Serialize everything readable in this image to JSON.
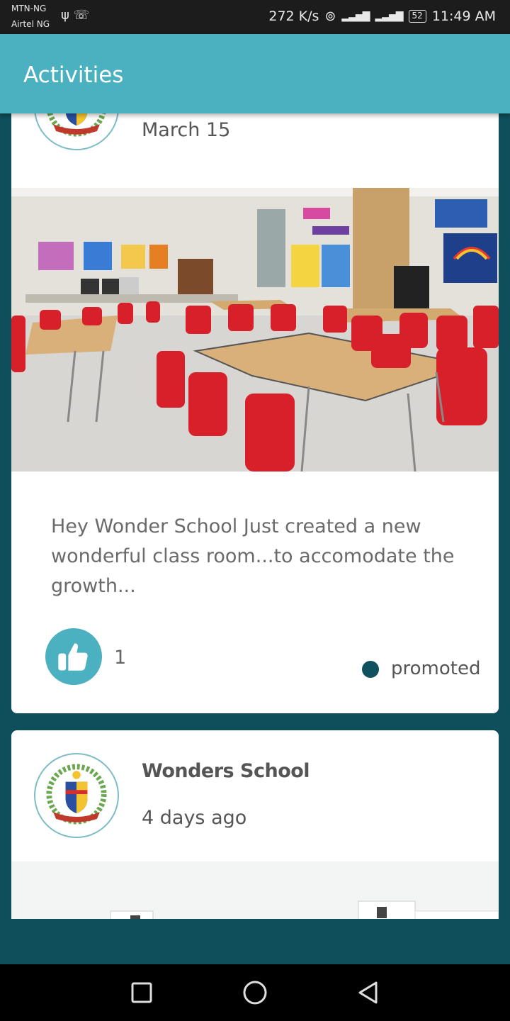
{
  "status_bar": {
    "carrier_1": "MTN-NG",
    "carrier_2": "Airtel NG",
    "speed": "272 K/s",
    "battery": "52",
    "time": "11:49 AM"
  },
  "app_bar": {
    "title": "Activities"
  },
  "posts": [
    {
      "date": "March 15",
      "text": "Hey Wonder School Just created a new wonderful class room...to accomodate the growth...",
      "likes": "1",
      "status": "promoted"
    },
    {
      "author": "Wonders School",
      "date": "4 days ago"
    }
  ],
  "colors": {
    "primary": "#4bb0bf",
    "background": "#0e4f5b",
    "status_dot": "#11505d"
  },
  "icons": [
    "usb-icon",
    "whatsapp-icon",
    "hotspot-icon",
    "signal-icon",
    "battery-icon",
    "thumbs-up-icon",
    "recent-apps-icon",
    "home-icon",
    "back-icon"
  ]
}
